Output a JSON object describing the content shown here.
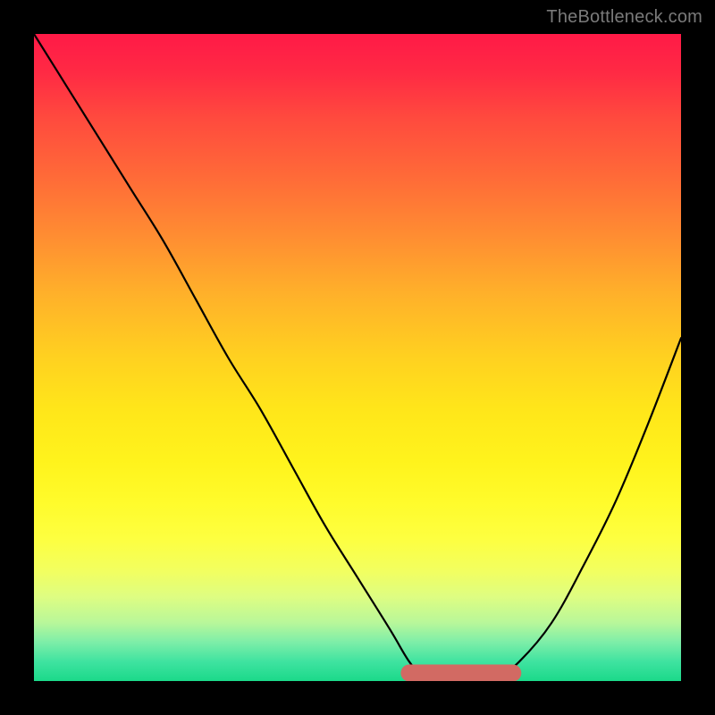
{
  "watermark": "TheBottleneck.com",
  "colors": {
    "frame": "#000000",
    "watermark": "#7a7a7a",
    "curve": "#000000",
    "valley_marker": "#d26a63",
    "gradient_top": "#ff1a47",
    "gradient_mid": "#ffe61a",
    "gradient_bottom": "#1bd98a"
  },
  "chart_data": {
    "type": "line",
    "title": "",
    "xlabel": "",
    "ylabel": "",
    "xlim": [
      0,
      100
    ],
    "ylim": [
      0,
      100
    ],
    "grid": false,
    "series": [
      {
        "name": "bottleneck-curve",
        "x": [
          0,
          5,
          10,
          15,
          20,
          25,
          30,
          35,
          40,
          45,
          50,
          55,
          58,
          60,
          63,
          66,
          69,
          72,
          75,
          80,
          85,
          90,
          95,
          100
        ],
        "y": [
          100,
          92,
          84,
          76,
          68,
          59,
          50,
          42,
          33,
          24,
          16,
          8,
          3,
          1,
          0,
          0,
          0,
          1,
          3,
          9,
          18,
          28,
          40,
          53
        ]
      }
    ],
    "annotations": [
      {
        "name": "optimal-range",
        "x_start": 58,
        "x_end": 74,
        "y": 0
      }
    ]
  }
}
